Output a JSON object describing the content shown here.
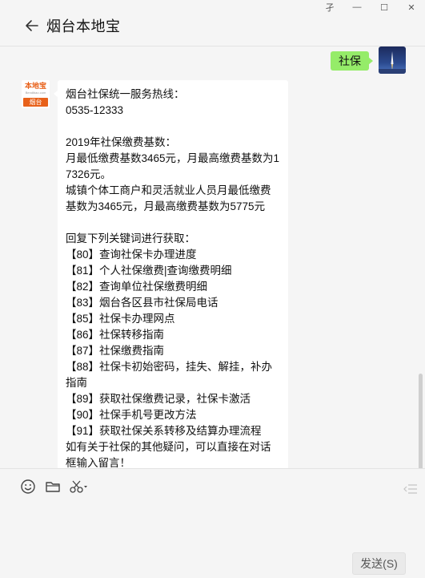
{
  "window": {
    "controls": [
      "孑",
      "—",
      "☐",
      "✕"
    ]
  },
  "header": {
    "title": "烟台本地宝"
  },
  "messages": {
    "outgoing": {
      "text": "社保"
    },
    "bot_avatar": {
      "brand": "本地宝",
      "domain": "Bendibao.com",
      "city": "烟台"
    },
    "incoming_lines": [
      "烟台社保统一服务热线：",
      "0535-12333",
      "",
      "2019年社保缴费基数：",
      "月最低缴费基数3465元，月最高缴费基数为17326元。",
      "城镇个体工商户和灵活就业人员月最低缴费基数为3465元，月最高缴费基数为5775元",
      "",
      "回复下列关键词进行获取：",
      "【80】查询社保卡办理进度",
      "【81】个人社保缴费|查询缴费明细",
      "【82】查询单位社保缴费明细",
      "【83】烟台各区县市社保局电话",
      "【85】社保卡办理网点",
      "【86】社保转移指南",
      "【87】社保缴费指南",
      "【88】社保卡初始密码，挂失、解挂，补办指南",
      "【89】获取社保缴费记录，社保卡激活",
      "【90】社保手机号更改方法",
      "【91】获取社保关系转移及结算办理流程",
      "如有关于社保的其他疑问，可以直接在对话框输入留言！"
    ]
  },
  "toolbar": {
    "emoji_icon": "emoji-icon",
    "folder_icon": "folder-icon",
    "scissors_icon": "scissors-icon",
    "send_label": "发送(S)"
  },
  "colors": {
    "outgoing_bubble": "#95ec69",
    "incoming_bubble": "#ffffff",
    "brand_orange": "#e8611a",
    "background": "#f5f5f5"
  }
}
